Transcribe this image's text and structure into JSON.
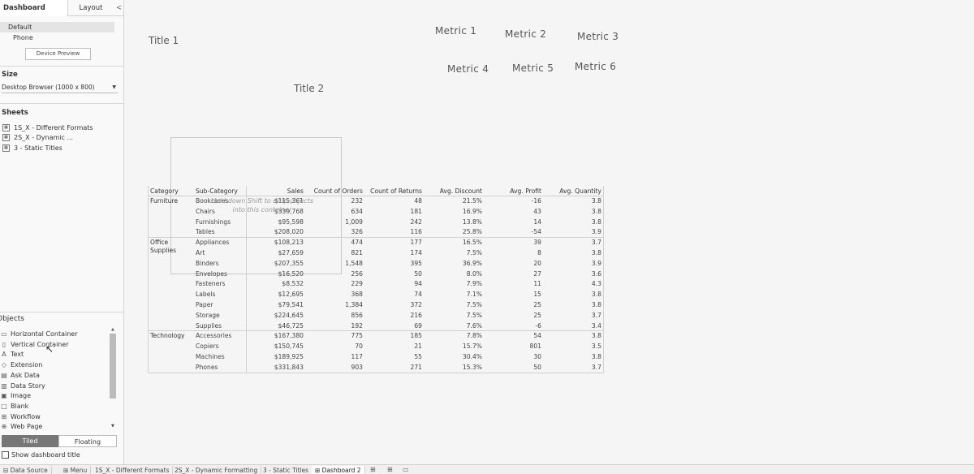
{
  "left_pane": {
    "tabs": {
      "dashboard": "Dashboard",
      "layout": "Layout",
      "collapse": "<"
    },
    "device_options": [
      "Default",
      "Phone"
    ],
    "device_preview_label": "Device Preview",
    "size_title": "Size",
    "size_value": "Desktop Browser (1000 x 800)",
    "sheets_title": "Sheets",
    "sheets": [
      "1S_X - Different Formats",
      "2S_X - Dynamic ...",
      "3 - Static Titles"
    ],
    "objects_title": "Objects",
    "objects": [
      {
        "icon": "horizontal-container-icon",
        "glyph": "▭",
        "label": "Horizontal Container"
      },
      {
        "icon": "vertical-container-icon",
        "glyph": "▯",
        "label": "Vertical Container"
      },
      {
        "icon": "text-icon",
        "glyph": "A",
        "label": "Text"
      },
      {
        "icon": "extension-icon",
        "glyph": "◇",
        "label": "Extension"
      },
      {
        "icon": "ask-data-icon",
        "glyph": "▤",
        "label": "Ask Data"
      },
      {
        "icon": "data-story-icon",
        "glyph": "▥",
        "label": "Data Story"
      },
      {
        "icon": "image-icon",
        "glyph": "▣",
        "label": "Image"
      },
      {
        "icon": "blank-icon",
        "glyph": "□",
        "label": "Blank"
      },
      {
        "icon": "workflow-icon",
        "glyph": "⊞",
        "label": "Workflow"
      },
      {
        "icon": "web-page-icon",
        "glyph": "⊕",
        "label": "Web Page"
      }
    ],
    "tiled_label": "Tiled",
    "floating_label": "Floating",
    "show_title_label": "Show dashboard title"
  },
  "canvas": {
    "title1": "Title 1",
    "title2": "Title 2",
    "metrics": [
      "Metric 1",
      "Metric 2",
      "Metric 3",
      "Metric 4",
      "Metric 5",
      "Metric 6"
    ],
    "drop_hint": "Hold down Shift to drop objects into this container"
  },
  "table": {
    "headers": [
      "Category",
      "Sub-Category",
      "Sales",
      "Count of Orders",
      "Count of Returns",
      "Avg. Discount",
      "Avg. Profit",
      "Avg. Quantity"
    ],
    "groups": [
      {
        "category": "Furniture",
        "rows": [
          [
            "Bookcases",
            "$115,361",
            "232",
            "48",
            "21.5%",
            "-16",
            "3.8"
          ],
          [
            "Chairs",
            "$339,768",
            "634",
            "181",
            "16.9%",
            "43",
            "3.8"
          ],
          [
            "Furnishings",
            "$95,598",
            "1,009",
            "242",
            "13.8%",
            "14",
            "3.8"
          ],
          [
            "Tables",
            "$208,020",
            "326",
            "116",
            "25.8%",
            "-54",
            "3.9"
          ]
        ]
      },
      {
        "category": "Office Supplies",
        "rows": [
          [
            "Appliances",
            "$108,213",
            "474",
            "177",
            "16.5%",
            "39",
            "3.7"
          ],
          [
            "Art",
            "$27,659",
            "821",
            "174",
            "7.5%",
            "8",
            "3.8"
          ],
          [
            "Binders",
            "$207,355",
            "1,548",
            "395",
            "36.9%",
            "20",
            "3.9"
          ],
          [
            "Envelopes",
            "$16,520",
            "256",
            "50",
            "8.0%",
            "27",
            "3.6"
          ],
          [
            "Fasteners",
            "$8,532",
            "229",
            "94",
            "7.9%",
            "11",
            "4.3"
          ],
          [
            "Labels",
            "$12,695",
            "368",
            "74",
            "7.1%",
            "15",
            "3.8"
          ],
          [
            "Paper",
            "$79,541",
            "1,384",
            "372",
            "7.5%",
            "25",
            "3.8"
          ],
          [
            "Storage",
            "$224,645",
            "856",
            "216",
            "7.5%",
            "25",
            "3.7"
          ],
          [
            "Supplies",
            "$46,725",
            "192",
            "69",
            "7.6%",
            "-6",
            "3.4"
          ]
        ]
      },
      {
        "category": "Technology",
        "rows": [
          [
            "Accessories",
            "$167,380",
            "775",
            "185",
            "7.8%",
            "54",
            "3.8"
          ],
          [
            "Copiers",
            "$150,745",
            "70",
            "21",
            "15.7%",
            "801",
            "3.5"
          ],
          [
            "Machines",
            "$189,925",
            "117",
            "55",
            "30.4%",
            "30",
            "3.8"
          ],
          [
            "Phones",
            "$331,843",
            "903",
            "271",
            "15.3%",
            "50",
            "3.7"
          ]
        ]
      }
    ]
  },
  "bottom_tabs": {
    "data_source": "Data Source",
    "sheets": [
      "Menu",
      "1S_X - Different Formats",
      "2S_X - Dynamic Formatting",
      "3 - Static Titles",
      "Dashboard 2"
    ],
    "active": "Dashboard 2"
  }
}
